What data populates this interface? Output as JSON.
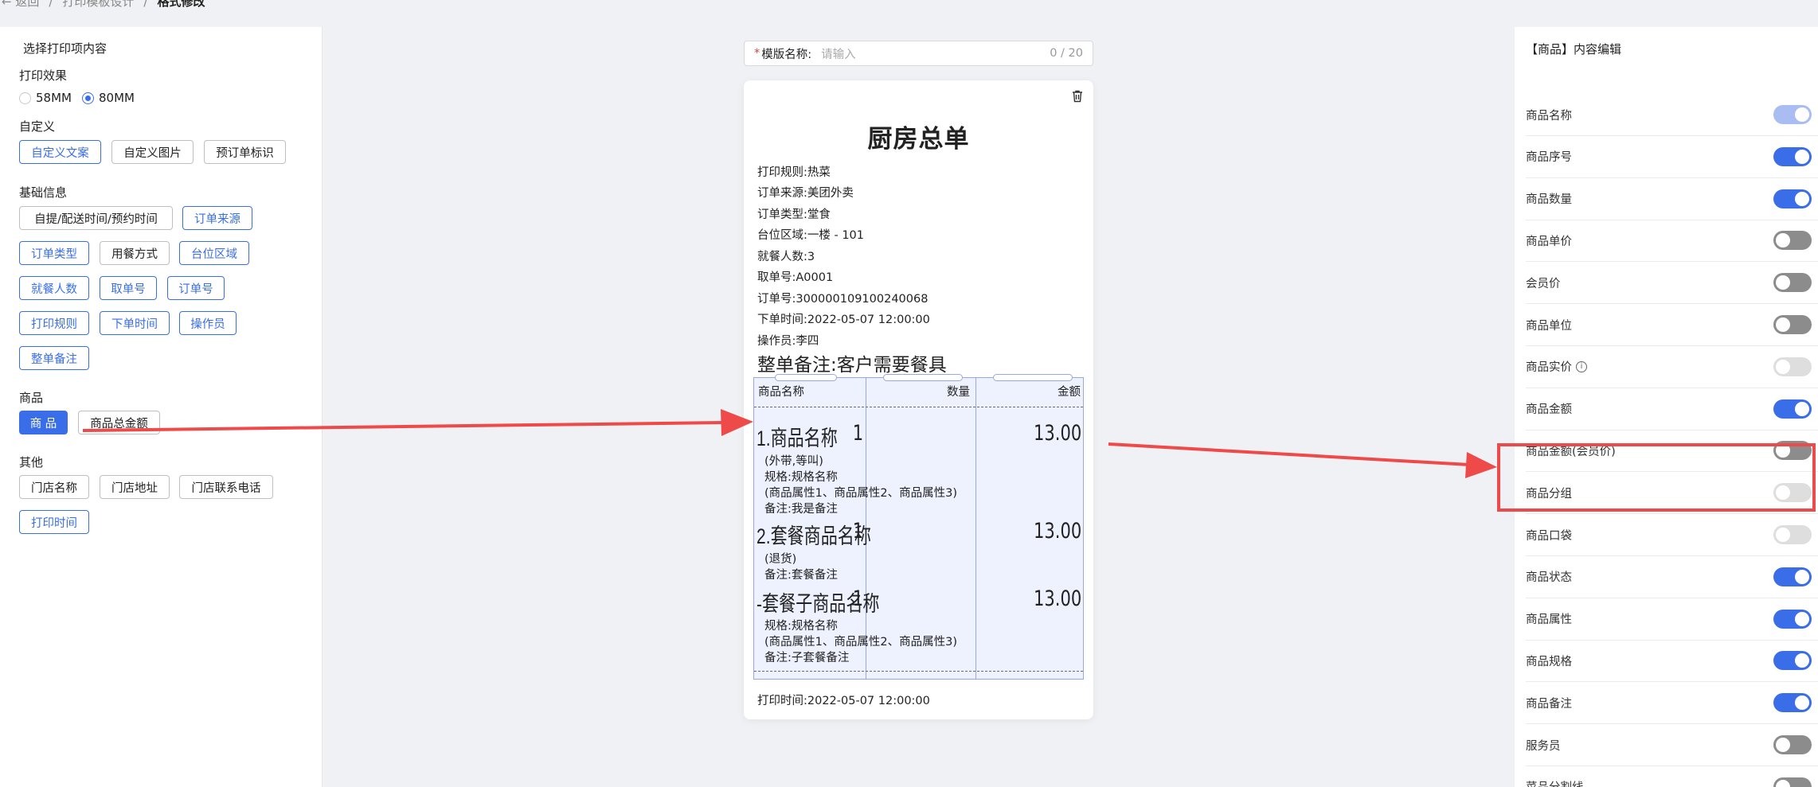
{
  "breadcrumb": {
    "back": "← 返回",
    "sep": "/",
    "parent": "打印模板设计",
    "current": "格式修改"
  },
  "left": {
    "title": "选择打印项内容",
    "print_effect": {
      "label": "打印效果",
      "options": [
        "58MM",
        "80MM"
      ],
      "selected": "80MM"
    },
    "custom": {
      "label": "自定义",
      "chips": [
        "自定义文案",
        "自定义图片",
        "预订单标识"
      ]
    },
    "basic": {
      "label": "基础信息",
      "chips": [
        "自提/配送时间/预约时间",
        "订单来源",
        "订单类型",
        "用餐方式",
        "台位区域",
        "就餐人数",
        "取单号",
        "订单号",
        "打印规则",
        "下单时间",
        "操作员",
        "整单备注"
      ]
    },
    "goods": {
      "label": "商品",
      "chips": [
        "商 品",
        "商品总金额"
      ]
    },
    "other": {
      "label": "其他",
      "chips": [
        "门店名称",
        "门店地址",
        "门店联系电话",
        "打印时间"
      ]
    }
  },
  "template_name": {
    "required_mark": "*",
    "label": "模版名称:",
    "placeholder": "请输入",
    "count": "0 / 20"
  },
  "receipt": {
    "title": "厨房总单",
    "lines": [
      "打印规则:热菜",
      "订单来源:美团外卖",
      "订单类型:堂食",
      "台位区域:一楼 - 101",
      "就餐人数:3",
      "取单号:A0001",
      "订单号:300000109100240068",
      "下单时间:2022-05-07 12:00:00",
      "操作员:李四"
    ],
    "note": "整单备注:客户需要餐具",
    "table": {
      "headers": [
        "商品名称",
        "数量",
        "金额"
      ],
      "items": [
        {
          "name": "1.商品名称",
          "qty": "1",
          "amount": "13.00",
          "details": [
            "(外带,等叫)",
            "规格:规格名称",
            "(商品属性1、商品属性2、商品属性3)",
            "备注:我是备注"
          ]
        },
        {
          "name": "2.套餐商品名称",
          "qty": "1",
          "amount": "13.00",
          "details": [
            "(退货)",
            "备注:套餐备注"
          ]
        },
        {
          "name": "-套餐子商品名称",
          "qty": "1",
          "amount": "13.00",
          "details": [
            "规格:规格名称",
            "(商品属性1、商品属性2、商品属性3)",
            "备注:子套餐备注"
          ]
        }
      ]
    },
    "print_time": "打印时间:2022-05-07 12:00:00"
  },
  "right": {
    "title": "【商品】内容编辑",
    "rows": [
      {
        "label": "商品名称",
        "on": true,
        "disabled": true
      },
      {
        "label": "商品序号",
        "on": true
      },
      {
        "label": "商品数量",
        "on": true
      },
      {
        "label": "商品单价",
        "on": false
      },
      {
        "label": "会员价",
        "on": false
      },
      {
        "label": "商品单位",
        "on": false
      },
      {
        "label": "商品实价",
        "on": false,
        "disabled": true,
        "info": true
      },
      {
        "label": "商品金额",
        "on": true
      },
      {
        "label": "商品金额(会员价)",
        "on": false
      },
      {
        "label": "商品分组",
        "on": false,
        "disabled": true
      },
      {
        "label": "商品口袋",
        "on": false,
        "disabled": true
      },
      {
        "label": "商品状态",
        "on": true
      },
      {
        "label": "商品属性",
        "on": true
      },
      {
        "label": "商品规格",
        "on": true
      },
      {
        "label": "商品备注",
        "on": true
      },
      {
        "label": "服务员",
        "on": false
      },
      {
        "label": "菜品分割线",
        "on": false
      }
    ]
  },
  "colors": {
    "accent": "#3a6ee8",
    "annotation": "#ef4a4a"
  }
}
